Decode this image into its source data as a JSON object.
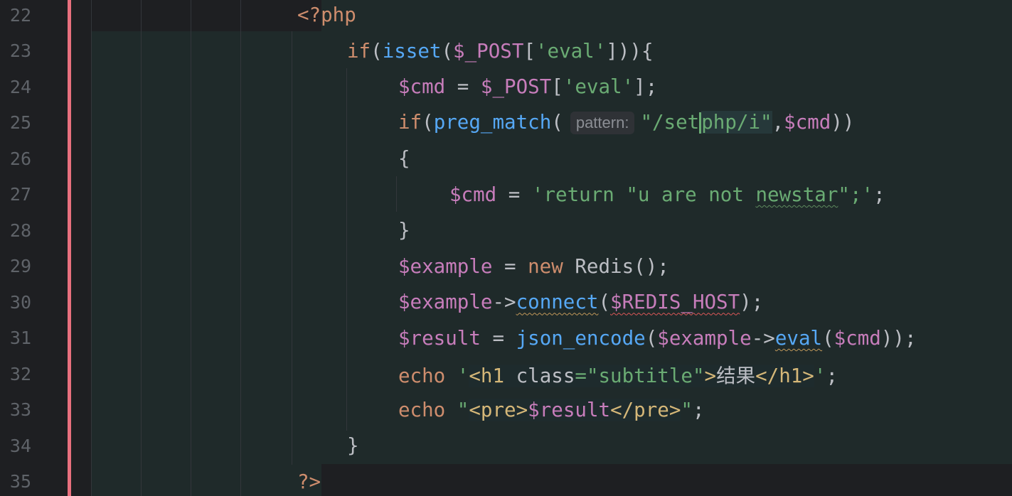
{
  "editor": {
    "line_numbers": [
      "22",
      "23",
      "24",
      "25",
      "26",
      "27",
      "28",
      "29",
      "30",
      "31",
      "32",
      "33",
      "34",
      "35"
    ],
    "lines": {
      "l22": {
        "open_tag": "<?php"
      },
      "l23": {
        "kw_if": "if",
        "p1": "(",
        "fn_isset": "isset",
        "p2": "(",
        "var_post": "$_POST",
        "b1": "[",
        "str": "'eval'",
        "b2": "]",
        "tail": ")){"
      },
      "l24": {
        "var_cmd": "$cmd",
        "eq": " = ",
        "var_post": "$_POST",
        "b1": "[",
        "str": "'eval'",
        "tail": "];"
      },
      "l25": {
        "kw_if": "if",
        "p1": "(",
        "fn": "preg_match",
        "p2": "(",
        "hint": "pattern:",
        "str_a": "\"/set",
        "str_b": "php/i\"",
        "comma": ",",
        "var_cmd": "$cmd",
        "tail": "))"
      },
      "l26": {
        "brace": "{"
      },
      "l27": {
        "var_cmd": "$cmd",
        "eq": " = ",
        "str_a": "'return \"u are not ",
        "str_b": "newstar",
        "str_c": "\";'",
        "tail": ";"
      },
      "l28": {
        "brace": "}"
      },
      "l29": {
        "var": "$example",
        "eq": " = ",
        "kw_new": "new",
        "cls": " Redis",
        "tail": "();"
      },
      "l30": {
        "var": "$example",
        "arrow": "->",
        "fn": "connect",
        "p1": "(",
        "var_host": "$REDIS_HOST",
        "tail": ");"
      },
      "l31": {
        "var": "$result",
        "eq": " = ",
        "fn": "json_encode",
        "p1": "(",
        "var_ex": "$example",
        "arrow": "->",
        "fn_eval": "eval",
        "p2": "(",
        "var_cmd": "$cmd",
        "tail": "));"
      },
      "l32": {
        "kw": "echo",
        "sp": " ",
        "q1": "'",
        "tag_open": "<h1",
        "attr": " class",
        "eqs": "=",
        "attr_val": "\"subtitle\"",
        "tag_gt": ">",
        "text": "结果",
        "tag_close": "</h1>",
        "q2": "'",
        "tail": ";"
      },
      "l33": {
        "kw": "echo",
        "sp": " ",
        "q1": "\"",
        "tag_open": "<pre>",
        "var": "$result",
        "tag_close": "</pre>",
        "q2": "\"",
        "tail": ";"
      },
      "l34": {
        "brace": "}"
      },
      "l35": {
        "close_tag": "?>"
      }
    }
  },
  "colors": {
    "background": "#1e1f22",
    "vcs_change_bar": "#e8707e",
    "keyword": "#ce8d6d",
    "function": "#56a8f5",
    "variable": "#c77dbb",
    "string": "#6aab73",
    "html_tag": "#d5b778"
  }
}
